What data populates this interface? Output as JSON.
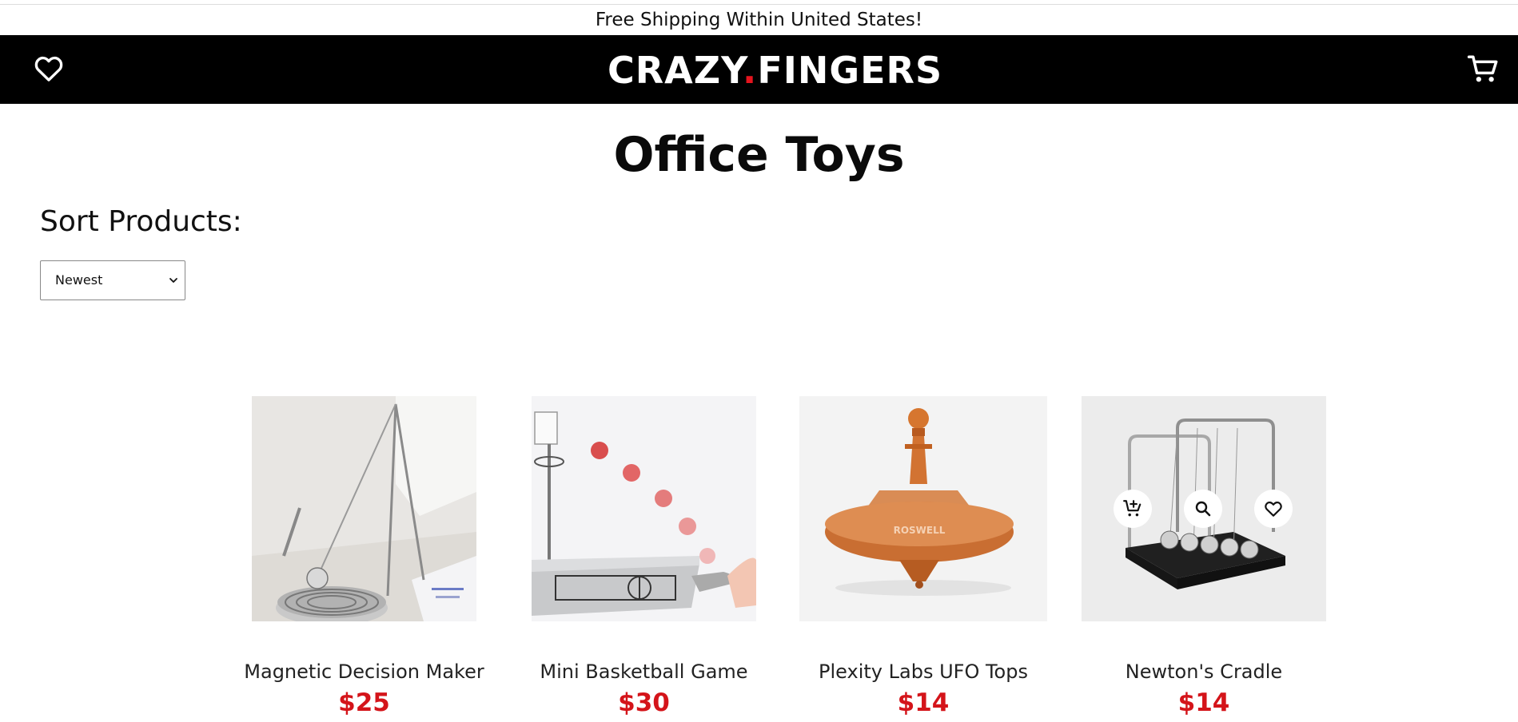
{
  "announcement": "Free Shipping Within United States!",
  "header": {
    "logo_left": "CRAZY",
    "logo_dot": ".",
    "logo_right": "FINGERS",
    "wishlist_icon": "heart-outline-icon",
    "cart_icon": "shopping-cart-icon"
  },
  "page": {
    "title": "Office Toys",
    "sort_label": "Sort Products:",
    "sort_selected": "Newest"
  },
  "products": [
    {
      "name": "Magnetic Decision Maker",
      "price": "$25"
    },
    {
      "name": "Mini Basketball Game",
      "price": "$30"
    },
    {
      "name": "Plexity Labs UFO Tops",
      "price": "$14",
      "engraving": "ROSWELL"
    },
    {
      "name": "Newton's Cradle",
      "price": "$14"
    }
  ],
  "card_actions": [
    "add-to-cart-icon",
    "search-icon",
    "heart-outline-icon"
  ],
  "colors": {
    "header_bg": "#000000",
    "price": "#d4141a",
    "accent_dot": "#e5141e"
  }
}
